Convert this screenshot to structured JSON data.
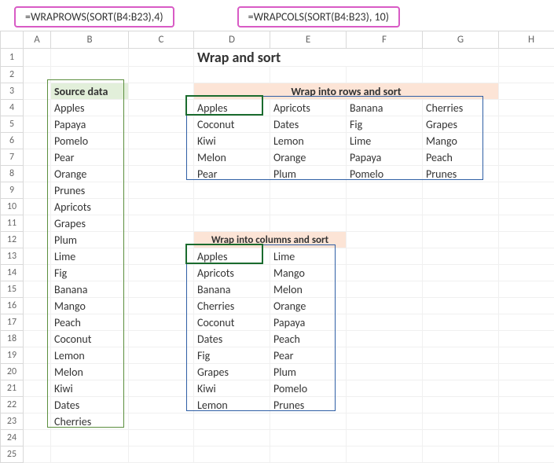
{
  "formulas": {
    "left": "=WRAPROWS(SORT(B4:B23),4)",
    "right": "=WRAPCOLS(SORT(B4:B23), 10)"
  },
  "title": "Wrap and sort",
  "columns": [
    "",
    "A",
    "B",
    "C",
    "D",
    "E",
    "F",
    "G",
    "H"
  ],
  "headers": {
    "source": "Source data",
    "rows_sort": "Wrap into rows and sort",
    "cols_sort": "Wrap into columns and sort"
  },
  "source": [
    "Apples",
    "Papaya",
    "Pomelo",
    "Pear",
    "Orange",
    "Prunes",
    "Apricots",
    "Grapes",
    "Plum",
    "Lime",
    "Fig",
    "Banana",
    "Mango",
    "Peach",
    "Coconut",
    "Lemon",
    "Melon",
    "Kiwi",
    "Dates",
    "Cherries"
  ],
  "wraprows": [
    [
      "Apples",
      "Apricots",
      "Banana",
      "Cherries"
    ],
    [
      "Coconut",
      "Dates",
      "Fig",
      "Grapes"
    ],
    [
      "Kiwi",
      "Lemon",
      "Lime",
      "Mango"
    ],
    [
      "Melon",
      "Orange",
      "Papaya",
      "Peach"
    ],
    [
      "Pear",
      "Plum",
      "Pomelo",
      "Prunes"
    ]
  ],
  "wrapcols": [
    [
      "Apples",
      "Lime"
    ],
    [
      "Apricots",
      "Mango"
    ],
    [
      "Banana",
      "Melon"
    ],
    [
      "Cherries",
      "Orange"
    ],
    [
      "Coconut",
      "Papaya"
    ],
    [
      "Dates",
      "Peach"
    ],
    [
      "Fig",
      "Pear"
    ],
    [
      "Grapes",
      "Plum"
    ],
    [
      "Kiwi",
      "Pomelo"
    ],
    [
      "Lemon",
      "Prunes"
    ]
  ],
  "chart_data": {
    "type": "table",
    "title": "Wrap and sort",
    "series": [
      {
        "name": "Source data",
        "values": [
          "Apples",
          "Papaya",
          "Pomelo",
          "Pear",
          "Orange",
          "Prunes",
          "Apricots",
          "Grapes",
          "Plum",
          "Lime",
          "Fig",
          "Banana",
          "Mango",
          "Peach",
          "Coconut",
          "Lemon",
          "Melon",
          "Kiwi",
          "Dates",
          "Cherries"
        ]
      },
      {
        "name": "Wrap into rows and sort",
        "values": [
          "Apples",
          "Apricots",
          "Banana",
          "Cherries",
          "Coconut",
          "Dates",
          "Fig",
          "Grapes",
          "Kiwi",
          "Lemon",
          "Lime",
          "Mango",
          "Melon",
          "Orange",
          "Papaya",
          "Peach",
          "Pear",
          "Plum",
          "Pomelo",
          "Prunes"
        ]
      },
      {
        "name": "Wrap into columns and sort",
        "values": [
          "Apples",
          "Apricots",
          "Banana",
          "Cherries",
          "Coconut",
          "Dates",
          "Fig",
          "Grapes",
          "Kiwi",
          "Lemon",
          "Lime",
          "Mango",
          "Melon",
          "Orange",
          "Papaya",
          "Peach",
          "Pear",
          "Plum",
          "Pomelo",
          "Prunes"
        ]
      }
    ]
  }
}
